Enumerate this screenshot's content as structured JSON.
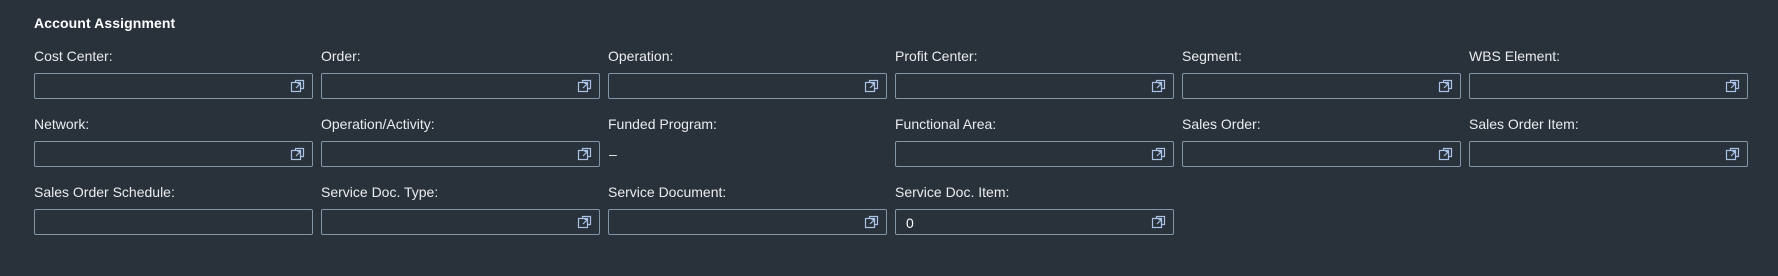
{
  "section": {
    "title": "Account Assignment"
  },
  "fields": [
    {
      "label": "Cost Center:",
      "value": "",
      "icon": "value-help-icon"
    },
    {
      "label": "Order:",
      "value": "",
      "icon": "value-help-icon"
    },
    {
      "label": "Operation:",
      "value": "",
      "icon": "value-help-icon"
    },
    {
      "label": "Profit Center:",
      "value": "",
      "icon": "value-help-icon"
    },
    {
      "label": "Segment:",
      "value": "",
      "icon": "value-help-icon"
    },
    {
      "label": "WBS Element:",
      "value": "",
      "icon": "value-help-icon"
    },
    {
      "label": "Network:",
      "value": "",
      "icon": "value-help-icon"
    },
    {
      "label": "Operation/Activity:",
      "value": "",
      "icon": "value-help-icon"
    },
    {
      "label": "Funded Program:",
      "value": "–"
    },
    {
      "label": "Functional Area:",
      "value": "",
      "icon": "value-help-icon"
    },
    {
      "label": "Sales Order:",
      "value": "",
      "icon": "value-help-icon"
    },
    {
      "label": "Sales Order Item:",
      "value": "",
      "icon": "value-help-icon"
    },
    {
      "label": "Sales Order Schedule:",
      "value": ""
    },
    {
      "label": "Service Doc. Type:",
      "value": "",
      "icon": "value-help-icon"
    },
    {
      "label": "Service Document:",
      "value": "",
      "icon": "value-help-icon"
    },
    {
      "label": "Service Doc. Item:",
      "value": "0",
      "icon": "value-help-icon"
    }
  ],
  "colors": {
    "background": "#29313a",
    "field_border": "#8396a8",
    "icon": "#a9c2e5",
    "text": "#eaecee"
  }
}
